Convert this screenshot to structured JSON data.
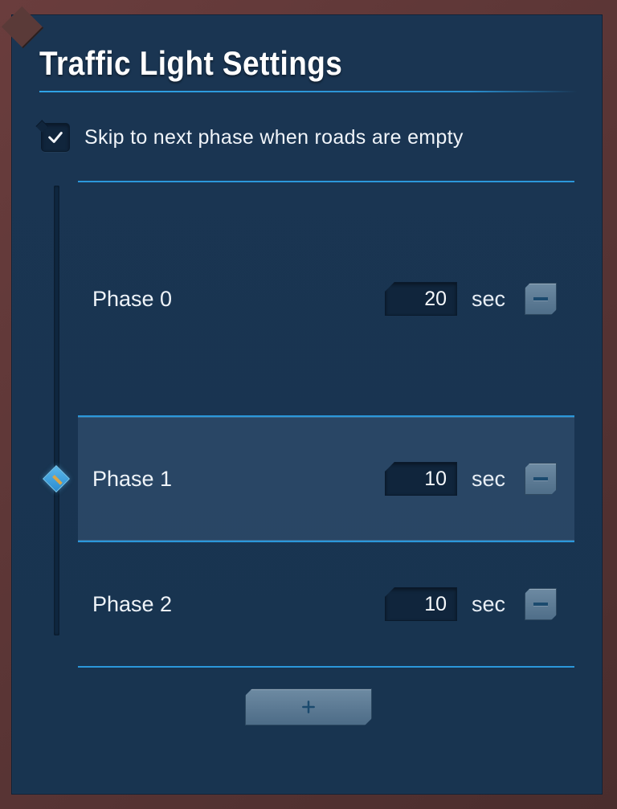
{
  "title": "Traffic Light Settings",
  "skip_checkbox": {
    "checked": true,
    "label": "Skip to next phase when roads are empty"
  },
  "unit_label": "sec",
  "phases": [
    {
      "label": "Phase 0",
      "seconds": "20",
      "active": false
    },
    {
      "label": "Phase 1",
      "seconds": "10",
      "active": true
    },
    {
      "label": "Phase 2",
      "seconds": "10",
      "active": false
    }
  ],
  "active_phase_index": 1
}
